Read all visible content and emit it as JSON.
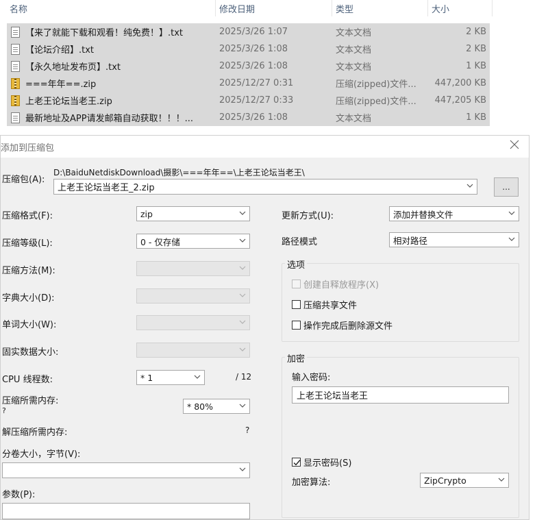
{
  "explorer": {
    "columns": {
      "name": "名称",
      "date": "修改日期",
      "type": "类型",
      "size": "大小"
    },
    "files": [
      {
        "icon": "text-file-icon",
        "name": "【来了就能下载和观看！纯免费！】.txt",
        "date": "2025/3/26 1:07",
        "type": "文本文档",
        "size": "2 KB"
      },
      {
        "icon": "text-file-icon",
        "name": "【论坛介绍】.txt",
        "date": "2025/3/26 1:08",
        "type": "文本文档",
        "size": "2 KB"
      },
      {
        "icon": "text-file-icon",
        "name": "【永久地址发布页】.txt",
        "date": "2025/3/26 1:08",
        "type": "文本文档",
        "size": "1 KB"
      },
      {
        "icon": "zip-file-icon",
        "name": "===年年==.zip",
        "date": "2025/12/27 0:31",
        "type": "压缩(zipped)文件...",
        "size": "447,200 KB"
      },
      {
        "icon": "zip-file-icon",
        "name": "上老王论坛当老王.zip",
        "date": "2025/12/27 0:33",
        "type": "压缩(zipped)文件...",
        "size": "447,205 KB"
      },
      {
        "icon": "text-file-icon",
        "name": "最新地址及APP请发邮箱自动获取！！！...",
        "date": "2025/3/26 1:08",
        "type": "文本文档",
        "size": "1 KB"
      }
    ]
  },
  "dialog": {
    "title": "添加到压缩包",
    "archive_label": "压缩包(A):",
    "archive_path": "D:\\BaiduNetdiskDownload\\摄影\\===年年==\\上老王论坛当老王\\",
    "archive_name": "上老王论坛当老王_2.zip",
    "browse_label": "...",
    "left": {
      "format_label": "压缩格式(F):",
      "format_value": "zip",
      "level_label": "压缩等级(L):",
      "level_value": "0 - 仅存储",
      "method_label": "压缩方法(M):",
      "dict_label": "字典大小(D):",
      "word_label": "单词大小(W):",
      "solid_label": "固实数据大小:",
      "cpu_label": "CPU 线程数:",
      "cpu_value": "* 1",
      "cpu_total": "/ 12",
      "mem_label": "压缩所需内存:",
      "mem_q": "?",
      "mem_value": "* 80%",
      "decomp_label": "解压缩所需内存:",
      "decomp_value": "?",
      "volume_label": "分卷大小，字节(V):",
      "volume_value": "",
      "params_label": "参数(P):",
      "params_value": ""
    },
    "right": {
      "update_label": "更新方式(U):",
      "update_value": "添加并替换文件",
      "path_label": "路径模式",
      "path_value": "相对路径",
      "options_title": "选项",
      "opt_sfx": "创建自释放程序(X)",
      "opt_shared": "压缩共享文件",
      "opt_delete": "操作完成后删除源文件",
      "encrypt_title": "加密",
      "password_label": "输入密码:",
      "password_value": "上老王论坛当老王",
      "show_password": "显示密码(S)",
      "algo_label": "加密算法:",
      "algo_value": "ZipCrypto"
    }
  }
}
